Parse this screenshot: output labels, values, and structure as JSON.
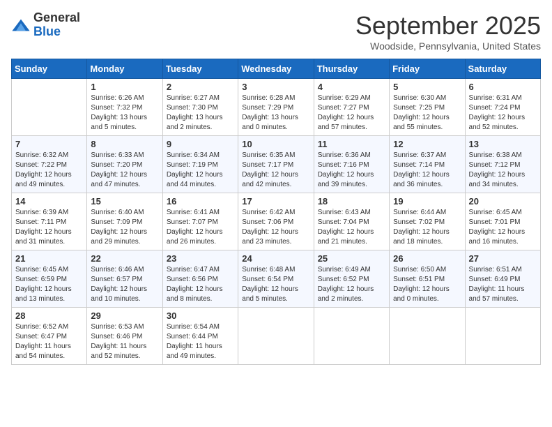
{
  "header": {
    "logo_general": "General",
    "logo_blue": "Blue",
    "month_title": "September 2025",
    "location": "Woodside, Pennsylvania, United States"
  },
  "days_of_week": [
    "Sunday",
    "Monday",
    "Tuesday",
    "Wednesday",
    "Thursday",
    "Friday",
    "Saturday"
  ],
  "weeks": [
    [
      {
        "day": "",
        "info": ""
      },
      {
        "day": "1",
        "info": "Sunrise: 6:26 AM\nSunset: 7:32 PM\nDaylight: 13 hours\nand 5 minutes."
      },
      {
        "day": "2",
        "info": "Sunrise: 6:27 AM\nSunset: 7:30 PM\nDaylight: 13 hours\nand 2 minutes."
      },
      {
        "day": "3",
        "info": "Sunrise: 6:28 AM\nSunset: 7:29 PM\nDaylight: 13 hours\nand 0 minutes."
      },
      {
        "day": "4",
        "info": "Sunrise: 6:29 AM\nSunset: 7:27 PM\nDaylight: 12 hours\nand 57 minutes."
      },
      {
        "day": "5",
        "info": "Sunrise: 6:30 AM\nSunset: 7:25 PM\nDaylight: 12 hours\nand 55 minutes."
      },
      {
        "day": "6",
        "info": "Sunrise: 6:31 AM\nSunset: 7:24 PM\nDaylight: 12 hours\nand 52 minutes."
      }
    ],
    [
      {
        "day": "7",
        "info": "Sunrise: 6:32 AM\nSunset: 7:22 PM\nDaylight: 12 hours\nand 49 minutes."
      },
      {
        "day": "8",
        "info": "Sunrise: 6:33 AM\nSunset: 7:20 PM\nDaylight: 12 hours\nand 47 minutes."
      },
      {
        "day": "9",
        "info": "Sunrise: 6:34 AM\nSunset: 7:19 PM\nDaylight: 12 hours\nand 44 minutes."
      },
      {
        "day": "10",
        "info": "Sunrise: 6:35 AM\nSunset: 7:17 PM\nDaylight: 12 hours\nand 42 minutes."
      },
      {
        "day": "11",
        "info": "Sunrise: 6:36 AM\nSunset: 7:16 PM\nDaylight: 12 hours\nand 39 minutes."
      },
      {
        "day": "12",
        "info": "Sunrise: 6:37 AM\nSunset: 7:14 PM\nDaylight: 12 hours\nand 36 minutes."
      },
      {
        "day": "13",
        "info": "Sunrise: 6:38 AM\nSunset: 7:12 PM\nDaylight: 12 hours\nand 34 minutes."
      }
    ],
    [
      {
        "day": "14",
        "info": "Sunrise: 6:39 AM\nSunset: 7:11 PM\nDaylight: 12 hours\nand 31 minutes."
      },
      {
        "day": "15",
        "info": "Sunrise: 6:40 AM\nSunset: 7:09 PM\nDaylight: 12 hours\nand 29 minutes."
      },
      {
        "day": "16",
        "info": "Sunrise: 6:41 AM\nSunset: 7:07 PM\nDaylight: 12 hours\nand 26 minutes."
      },
      {
        "day": "17",
        "info": "Sunrise: 6:42 AM\nSunset: 7:06 PM\nDaylight: 12 hours\nand 23 minutes."
      },
      {
        "day": "18",
        "info": "Sunrise: 6:43 AM\nSunset: 7:04 PM\nDaylight: 12 hours\nand 21 minutes."
      },
      {
        "day": "19",
        "info": "Sunrise: 6:44 AM\nSunset: 7:02 PM\nDaylight: 12 hours\nand 18 minutes."
      },
      {
        "day": "20",
        "info": "Sunrise: 6:45 AM\nSunset: 7:01 PM\nDaylight: 12 hours\nand 16 minutes."
      }
    ],
    [
      {
        "day": "21",
        "info": "Sunrise: 6:45 AM\nSunset: 6:59 PM\nDaylight: 12 hours\nand 13 minutes."
      },
      {
        "day": "22",
        "info": "Sunrise: 6:46 AM\nSunset: 6:57 PM\nDaylight: 12 hours\nand 10 minutes."
      },
      {
        "day": "23",
        "info": "Sunrise: 6:47 AM\nSunset: 6:56 PM\nDaylight: 12 hours\nand 8 minutes."
      },
      {
        "day": "24",
        "info": "Sunrise: 6:48 AM\nSunset: 6:54 PM\nDaylight: 12 hours\nand 5 minutes."
      },
      {
        "day": "25",
        "info": "Sunrise: 6:49 AM\nSunset: 6:52 PM\nDaylight: 12 hours\nand 2 minutes."
      },
      {
        "day": "26",
        "info": "Sunrise: 6:50 AM\nSunset: 6:51 PM\nDaylight: 12 hours\nand 0 minutes."
      },
      {
        "day": "27",
        "info": "Sunrise: 6:51 AM\nSunset: 6:49 PM\nDaylight: 11 hours\nand 57 minutes."
      }
    ],
    [
      {
        "day": "28",
        "info": "Sunrise: 6:52 AM\nSunset: 6:47 PM\nDaylight: 11 hours\nand 54 minutes."
      },
      {
        "day": "29",
        "info": "Sunrise: 6:53 AM\nSunset: 6:46 PM\nDaylight: 11 hours\nand 52 minutes."
      },
      {
        "day": "30",
        "info": "Sunrise: 6:54 AM\nSunset: 6:44 PM\nDaylight: 11 hours\nand 49 minutes."
      },
      {
        "day": "",
        "info": ""
      },
      {
        "day": "",
        "info": ""
      },
      {
        "day": "",
        "info": ""
      },
      {
        "day": "",
        "info": ""
      }
    ]
  ]
}
